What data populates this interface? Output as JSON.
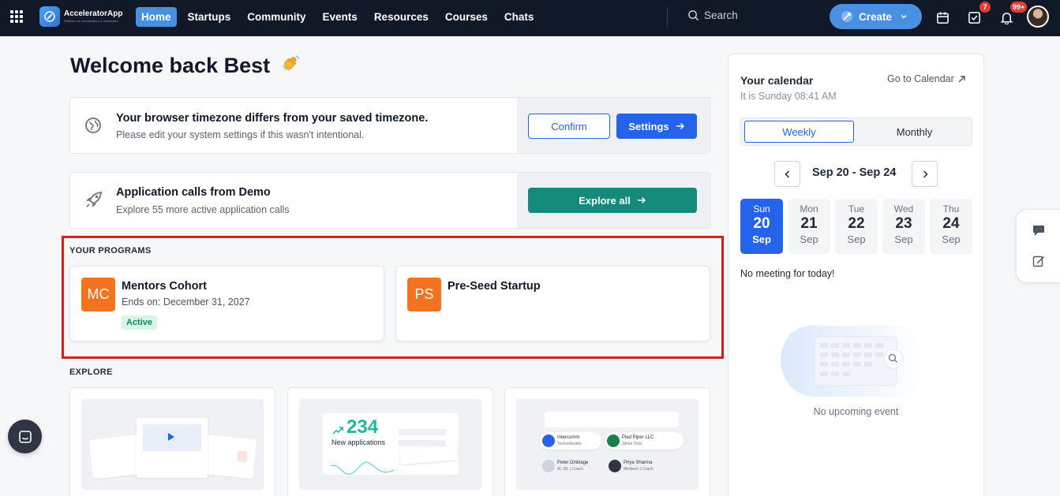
{
  "nav": {
    "app_name": "AcceleratorApp",
    "app_tagline": "Software for Accelerators & Incubators",
    "items": [
      {
        "label": "Home",
        "active": true
      },
      {
        "label": "Startups"
      },
      {
        "label": "Community"
      },
      {
        "label": "Events"
      },
      {
        "label": "Resources"
      },
      {
        "label": "Courses"
      },
      {
        "label": "Chats"
      }
    ],
    "search_placeholder": "Search",
    "create_label": "Create",
    "tasks_badge": "7",
    "notifications_badge": "99+"
  },
  "welcome": "Welcome back Best",
  "timezone_banner": {
    "title": "Your browser timezone differs from your saved timezone.",
    "subtitle": "Please edit your system settings if this wasn't intentional.",
    "confirm_label": "Confirm",
    "settings_label": "Settings"
  },
  "applications_banner": {
    "title": "Application calls from Demo",
    "subtitle": "Explore 55 more active application calls",
    "explore_label": "Explore all"
  },
  "programs": {
    "label": "YOUR PROGRAMS",
    "items": [
      {
        "initials": "MC",
        "name": "Mentors Cohort",
        "ends": "Ends on: December 31, 2027",
        "status": "Active"
      },
      {
        "initials": "PS",
        "name": "Pre-Seed Startup"
      }
    ]
  },
  "explore": {
    "label": "EXPLORE",
    "applications_count": "234",
    "applications_label": "New applications",
    "startups": [
      {
        "name": "Intercomm",
        "org": "Techcellerator"
      },
      {
        "name": "Pied Piper LLC",
        "org": "Jdrive Tech"
      },
      {
        "name": "Peter Dinklage",
        "org": "AI, ML | Coach"
      },
      {
        "name": "Priya Sharma",
        "org": "Medtech | Coach"
      }
    ]
  },
  "calendar": {
    "title": "Your calendar",
    "now": "It is Sunday 08:41 AM",
    "link": "Go to Calendar",
    "tabs": {
      "weekly": "Weekly",
      "monthly": "Monthly"
    },
    "range": "Sep 20 - Sep 24",
    "days": [
      {
        "dow": "Sun",
        "num": "20",
        "mon": "Sep",
        "selected": true
      },
      {
        "dow": "Mon",
        "num": "21",
        "mon": "Sep"
      },
      {
        "dow": "Tue",
        "num": "22",
        "mon": "Sep"
      },
      {
        "dow": "Wed",
        "num": "23",
        "mon": "Sep"
      },
      {
        "dow": "Thu",
        "num": "24",
        "mon": "Sep"
      }
    ],
    "no_meeting": "No meeting for today!",
    "no_event": "No upcoming event"
  },
  "colors": {
    "topbar": "#111827",
    "accent": "#2563eb",
    "teal": "#138a7a",
    "orange": "#f37321",
    "highlight": "#d61f1f"
  }
}
